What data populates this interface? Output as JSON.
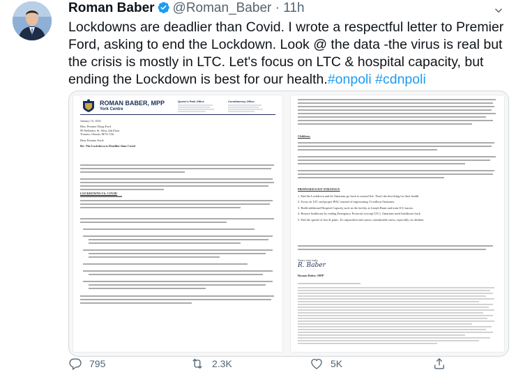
{
  "tweet": {
    "author_name": "Roman Baber",
    "handle": "@Roman_Baber",
    "separator": "·",
    "time": "11h",
    "text_main": "Lockdowns are deadlier than Covid. I wrote a respectful letter to Premier Ford, asking to end the Lockdown. Look @ the data -the virus is real but the crisis is mostly in LTC. Let's focus on LTC & hospital capacity, but ending the Lockdown is best for our health.",
    "hashtag_1": "#onpoli",
    "hashtag_2": "#cdnpoli",
    "replies": "795",
    "retweets": "2.3K",
    "likes": "5K"
  },
  "letter": {
    "letterhead_name": "ROMAN BABER, MPP",
    "letterhead_riding": "York Centre",
    "office_1_title": "Queen's Park Office",
    "office_2_title": "Constituency Office",
    "date": "January 15, 2021",
    "addressee_1": "Hon. Premier Doug Ford",
    "addressee_2": "99 Wellesley St. West, 6th Floor",
    "addressee_3": "Toronto, Ontario M7A 1A6",
    "salutation": "Dear Premier Ford:",
    "re_line": "Re: The Lockdown is Deadlier than Covid",
    "section_lockdowns": "LOCKDOWNS VS. COVID",
    "section_children": "Children:",
    "section_exit": "PROPOSED EXIT STRATEGY",
    "exit_1": "1. End the Lockdown and let Ontarians go back to normal life. That's the best thing for their health.",
    "exit_2": "2. Focus on LTC and proper IPAC instead of imprisoning 15 million Ontarians.",
    "exit_3": "3. Build additional Hospital Capacity such as the facility at Joseph Brant and train ICU nurses.",
    "exit_4": "4. Restore healthcare by ending Emergency Protocols (except LTC). Ontarians need healthcare back.",
    "exit_5": "5. End the spread of fear & panic. It's unjustified and causes considerable stress, especially on children.",
    "closing": "Yours very truly,",
    "signature": "R. Baber",
    "signoff_name": "Roman Baber, MPP"
  },
  "colors": {
    "link": "#1d9bf0",
    "verified": "#1d9bf0",
    "muted": "#536471"
  },
  "icons": [
    "verified-badge-icon",
    "more-options-icon",
    "reply-icon",
    "retweet-icon",
    "like-icon",
    "share-icon"
  ]
}
